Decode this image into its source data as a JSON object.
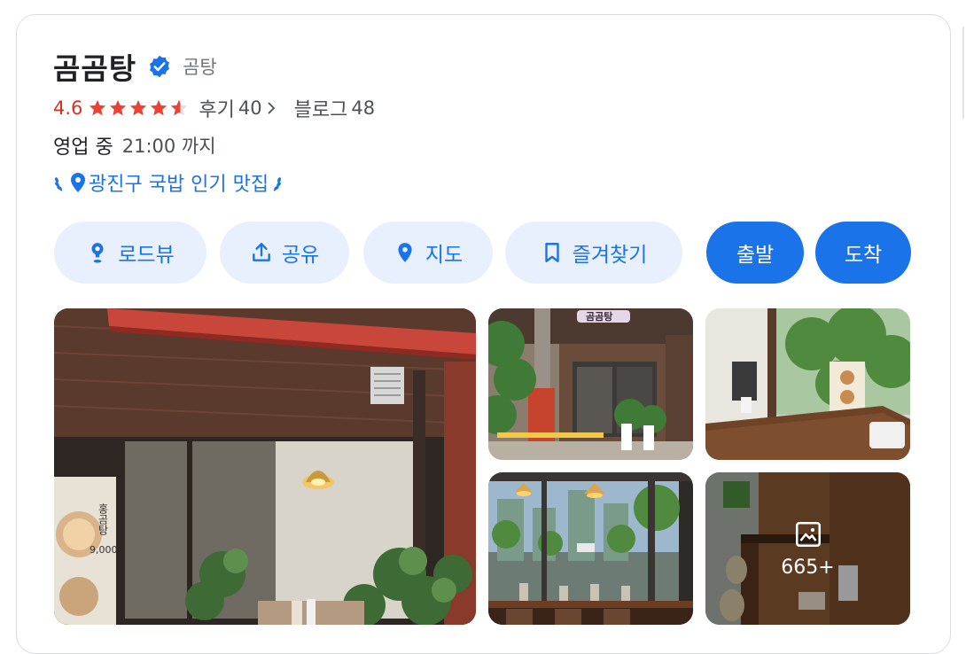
{
  "place": {
    "name": "곰곰탕",
    "category": "곰탕",
    "rating": "4.6",
    "rating_value": 4.6,
    "reviews_label": "후기",
    "reviews_count": "40",
    "blog_label": "블로그",
    "blog_count": "48",
    "open_status": "영업 중",
    "close_time": "21:00 까지",
    "award": "광진구 국밥 인기 맛집"
  },
  "actions": {
    "roadview": "로드뷰",
    "share": "공유",
    "map": "지도",
    "bookmark": "즐겨찾기",
    "depart": "출발",
    "arrive": "도착"
  },
  "photos": {
    "more_count": "665+",
    "sign_text": "곰곰탕",
    "menu_text": "홍곰탕",
    "menu_price": "9,000"
  },
  "colors": {
    "accent": "#1a73e8",
    "accent_light": "#e8f0fe",
    "rating_red": "#d93025",
    "star_red": "#ea4335"
  },
  "icons": {
    "verified": "verified-check-icon",
    "roadview": "street-view-pin-icon",
    "share": "share-upload-icon",
    "map": "map-pin-icon",
    "bookmark": "bookmark-icon",
    "gallery": "gallery-icon"
  }
}
